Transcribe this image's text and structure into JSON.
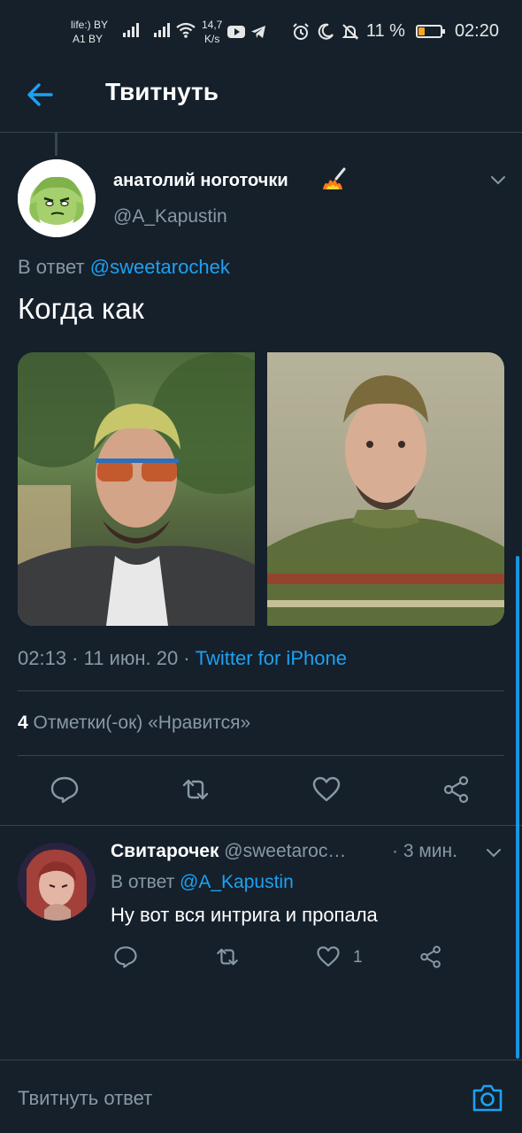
{
  "status_bar": {
    "carrier_line1": "life:) BY",
    "carrier_line2": "A1 BY",
    "speed_value": "14,7",
    "speed_unit": "K/s",
    "battery_percent": "11 %",
    "battery_level": 0.11,
    "time": "02:20"
  },
  "header": {
    "title": "Твитнуть"
  },
  "tweet": {
    "author_name": "анатолий ноготочки",
    "author_handle": "@A_Kapustin",
    "reply_prefix": "В ответ ",
    "reply_to": "@sweetarochek",
    "text": "Когда как",
    "timestamp": "02:13 · 11 июн. 20 · ",
    "source": "Twitter for iPhone",
    "likes_count": "4",
    "likes_label": " Отметки(-ок) «Нравится»"
  },
  "reply": {
    "author_name": "Свитарочек",
    "author_handle": " @sweetaroc…",
    "time": "· 3 мин.",
    "reply_prefix": "В ответ ",
    "reply_to": "@A_Kapustin",
    "text": "Ну вот вся интрига и пропала",
    "like_count": "1"
  },
  "composer": {
    "placeholder": "Твитнуть ответ"
  },
  "colors": {
    "background": "#15202b",
    "accent": "#1da1f2",
    "secondary_text": "#8899a6",
    "divider": "#38444d"
  }
}
